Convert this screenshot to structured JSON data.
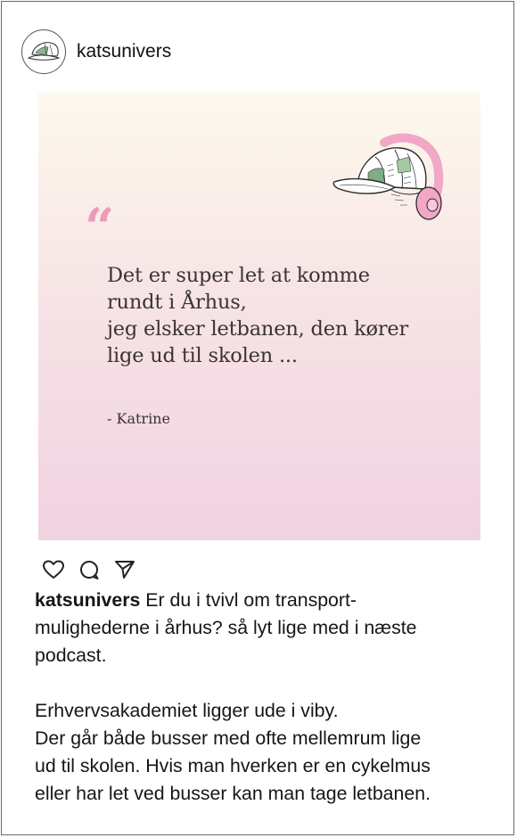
{
  "profile": {
    "username": "katsunivers",
    "avatar_icon": "cap-logo-icon"
  },
  "post": {
    "quote_mark": "“",
    "quote_text": "Det er super let at komme\nrundt i Århus,\njeg elsker letbanen, den kører\nlige ud til skolen ...",
    "quote_author": "- Katrine",
    "illustration_icon": "cap-with-headphones-icon",
    "colors": {
      "gradient_top": "#fdf9ec",
      "gradient_bottom": "#f0d2e1",
      "quote_mark": "#ec9ab9",
      "headphones": "#f2a7c6",
      "cap_green": "#7fae86"
    }
  },
  "actions": {
    "like_icon": "heart-icon",
    "comment_icon": "comment-bubble-icon",
    "share_icon": "send-paper-plane-icon"
  },
  "caption": {
    "username": "katsunivers",
    "text_line1": " Er du i tvivl om transport-\nmulighederne i århus? så lyt lige med i næste\npodcast.",
    "text_para2": "Erhvervsakademiet ligger ude i viby.\nDer går både busser med ofte mellemrum lige\nud til skolen. Hvis man hverken er en cykelmus\neller har let ved busser kan man tage letbanen."
  }
}
